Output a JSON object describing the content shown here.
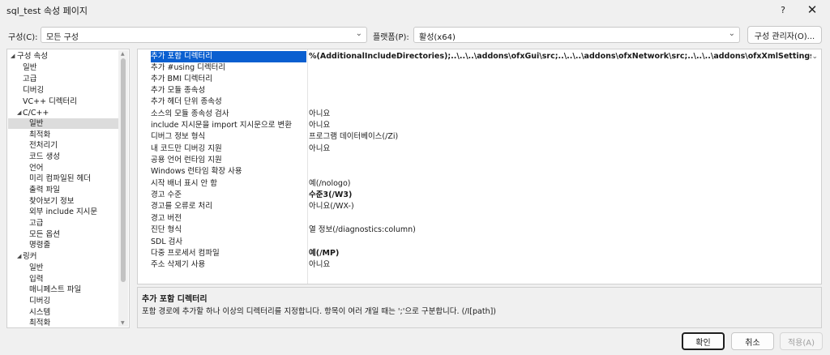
{
  "window": {
    "title": "sql_test 속성 페이지",
    "help": "?",
    "close": "✕"
  },
  "toolbar": {
    "config_label": "구성(C):",
    "config_value": "모든 구성",
    "platform_label": "플랫폼(P):",
    "platform_value": "활성(x64)",
    "config_manager_button": "구성 관리자(O)..."
  },
  "tree": {
    "items": [
      {
        "label": "구성 속성",
        "expanded": true
      },
      {
        "label": "일반"
      },
      {
        "label": "고급"
      },
      {
        "label": "디버깅"
      },
      {
        "label": "VC++ 디렉터리"
      },
      {
        "label": "C/C++",
        "expanded": true
      },
      {
        "label": "일반",
        "selected": true
      },
      {
        "label": "최적화"
      },
      {
        "label": "전처리기"
      },
      {
        "label": "코드 생성"
      },
      {
        "label": "언어"
      },
      {
        "label": "미리 컴파일된 헤더"
      },
      {
        "label": "출력 파일"
      },
      {
        "label": "찾아보기 정보"
      },
      {
        "label": "외부 include 지시문"
      },
      {
        "label": "고급"
      },
      {
        "label": "모든 옵션"
      },
      {
        "label": "명령줄"
      },
      {
        "label": "링커",
        "expanded": true
      },
      {
        "label": "일반"
      },
      {
        "label": "입력"
      },
      {
        "label": "매니페스트 파일"
      },
      {
        "label": "디버깅"
      },
      {
        "label": "시스템"
      },
      {
        "label": "최적화"
      }
    ]
  },
  "properties": [
    {
      "name": "추가 포함 디렉터리",
      "value": "%(AdditionalIncludeDirectories);..\\..\\..\\addons\\ofxGui\\src;..\\..\\..\\addons\\ofxNetwork\\src;..\\..\\..\\addons\\ofxXmlSettings\\libs;..\\",
      "selected": true,
      "bold": true
    },
    {
      "name": "추가 #using 디렉터리",
      "value": ""
    },
    {
      "name": "추가 BMI 디렉터리",
      "value": ""
    },
    {
      "name": "추가 모듈 종속성",
      "value": ""
    },
    {
      "name": "추가 헤더 단위 종속성",
      "value": ""
    },
    {
      "name": "소스의 모듈 종속성 검사",
      "value": "아니요"
    },
    {
      "name": "include 지시문을 import 지시문으로 변환",
      "value": "아니요"
    },
    {
      "name": "디버그 정보 형식",
      "value": "프로그램 데이터베이스(/Zi)"
    },
    {
      "name": "내 코드만 디버깅 지원",
      "value": "아니요"
    },
    {
      "name": "공용 언어 런타임 지원",
      "value": ""
    },
    {
      "name": "Windows 런타임 확장 사용",
      "value": ""
    },
    {
      "name": "시작 배너 표시 안 함",
      "value": "예(/nologo)"
    },
    {
      "name": "경고 수준",
      "value": "수준3(/W3)",
      "bold": true
    },
    {
      "name": "경고를 오류로 처리",
      "value": "아니요(/WX-)"
    },
    {
      "name": "경고 버전",
      "value": ""
    },
    {
      "name": "진단 형식",
      "value": "열 정보(/diagnostics:column)"
    },
    {
      "name": "SDL 검사",
      "value": ""
    },
    {
      "name": "다중 프로세서 컴파일",
      "value": "예(/MP)",
      "bold": true
    },
    {
      "name": "주소 삭제기 사용",
      "value": "아니요"
    }
  ],
  "description": {
    "title": "추가 포함 디렉터리",
    "text": "포함 경로에 추가할 하나 이상의 디렉터리를 지정합니다. 항목이 여러 개일 때는 ';'으로 구분합니다. (/I[path])"
  },
  "buttons": {
    "ok": "확인",
    "cancel": "취소",
    "apply": "적용(A)"
  }
}
